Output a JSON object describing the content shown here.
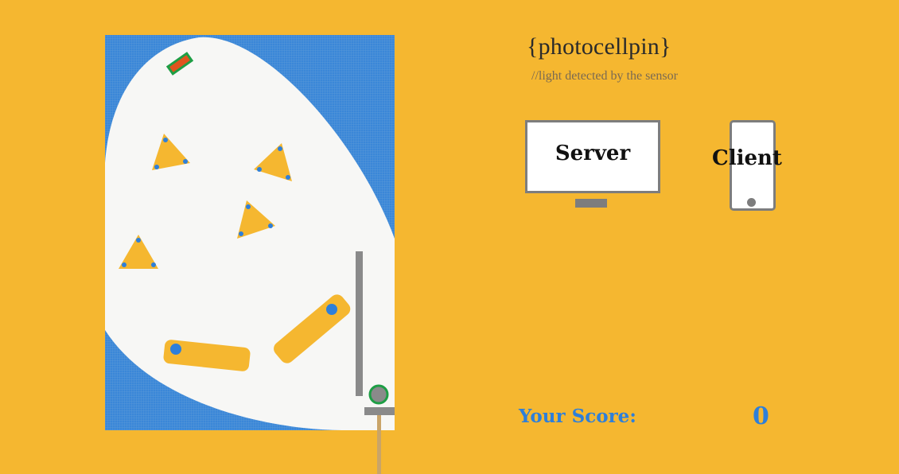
{
  "header": {
    "title": "{photocellpin}",
    "subtitle": "//light detected by the sensor"
  },
  "devices": {
    "server_label": "Server",
    "client_label": "Client"
  },
  "score": {
    "label": "Your Score:",
    "value": "0"
  },
  "colors": {
    "background": "#F5B730",
    "board_blue": "#3A87D8",
    "playfield": "#F7F7F5",
    "bumper": "#F5B730",
    "bumper_dot": "#2E7FD9",
    "rail_gray": "#8A8A8A",
    "ball_gray": "#8A8A8A",
    "ball_ring": "#1E9E45",
    "target_red": "#E0541E",
    "target_green": "#1E9E45",
    "score_blue": "#2E7FD9"
  },
  "icons": {
    "server": "monitor-icon",
    "client": "smartphone-icon"
  }
}
